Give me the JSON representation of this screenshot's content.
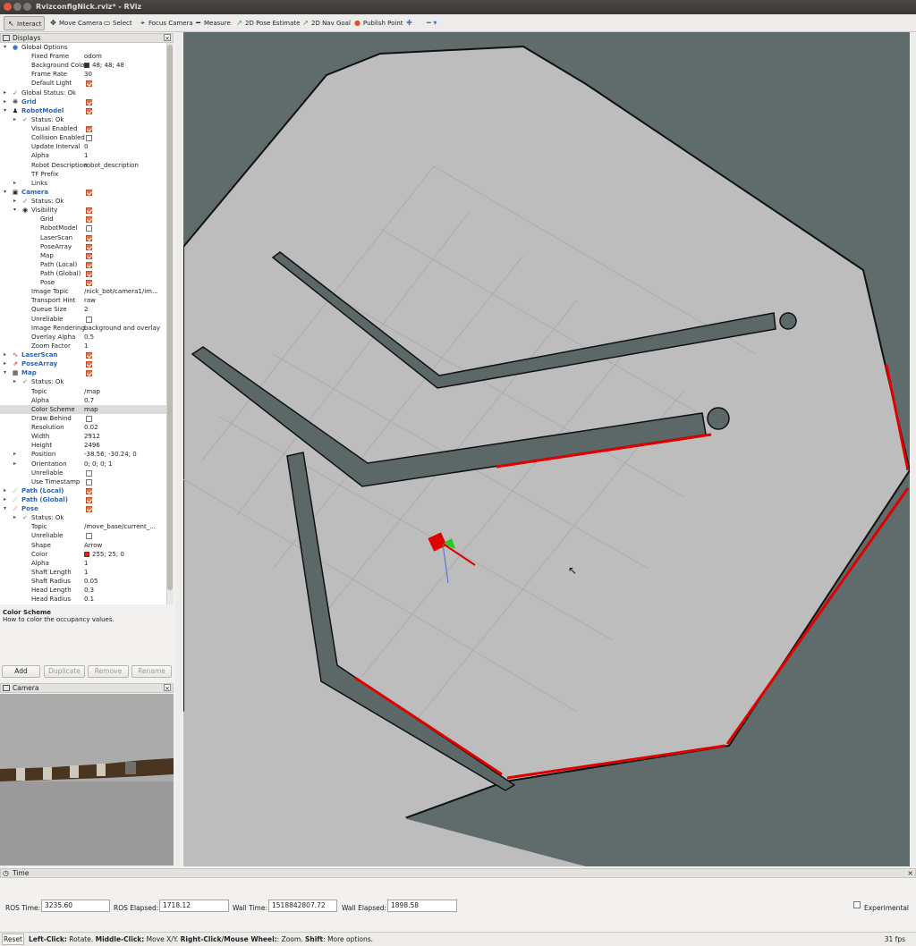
{
  "window": {
    "title": "RvizconfigNick.rviz* - RViz"
  },
  "toolbar": [
    {
      "label": "Interact",
      "icon": "cursor-icon",
      "glyph": "↖"
    },
    {
      "label": "Move Camera",
      "icon": "move-camera-icon",
      "glyph": "✥"
    },
    {
      "label": "Select",
      "icon": "select-icon",
      "glyph": "▭"
    },
    {
      "label": "Focus Camera",
      "icon": "focus-camera-icon",
      "glyph": "⌖"
    },
    {
      "label": "Measure",
      "icon": "measure-icon",
      "glyph": "━"
    },
    {
      "label": "2D Pose Estimate",
      "icon": "pose-estimate-icon",
      "glyph": "↗"
    },
    {
      "label": "2D Nav Goal",
      "icon": "nav-goal-icon",
      "glyph": "↗"
    },
    {
      "label": "Publish Point",
      "icon": "publish-point-icon",
      "glyph": "●"
    },
    {
      "label": "",
      "icon": "plus-icon",
      "glyph": "✚"
    },
    {
      "label": "",
      "icon": "minus-dropdown-icon",
      "glyph": "━ ▾"
    }
  ],
  "colors": {
    "map_gray": "#bdbdbd",
    "obstacle": "#5c6868",
    "laser_red": "#e00000",
    "grid_line": "#a8a8a8",
    "checkbox": "#e8744e",
    "background_color": "#303030",
    "pose_color": "#ff1900"
  },
  "displays": {
    "title": "Displays",
    "rows": [
      {
        "d": 0,
        "arrow": "▾",
        "icon": "globe-icon",
        "glyph": "●",
        "label": "Global Options"
      },
      {
        "d": 1,
        "label": "Fixed Frame",
        "value": "odom"
      },
      {
        "d": 1,
        "label": "Background Color",
        "value": "48; 48; 48",
        "swatch": "#303030"
      },
      {
        "d": 1,
        "label": "Frame Rate",
        "value": "30"
      },
      {
        "d": 1,
        "label": "Default Light",
        "check": true
      },
      {
        "d": 0,
        "arrow": "▸",
        "icon": "check-icon",
        "glyph": "✓",
        "label": "Global Status: Ok"
      },
      {
        "d": 0,
        "arrow": "▸",
        "icon": "grid-icon",
        "glyph": "❋",
        "label": "Grid",
        "blue": true,
        "check": true
      },
      {
        "d": 0,
        "arrow": "▾",
        "icon": "robot-model-icon",
        "glyph": "♟",
        "label": "RobotModel",
        "blue": true,
        "check": true
      },
      {
        "d": 1,
        "arrow": "▸",
        "icon": "check-icon",
        "glyph": "✓",
        "label": "Status: Ok"
      },
      {
        "d": 1,
        "label": "Visual Enabled",
        "check": true
      },
      {
        "d": 1,
        "label": "Collision Enabled",
        "check": false
      },
      {
        "d": 1,
        "label": "Update Interval",
        "value": "0"
      },
      {
        "d": 1,
        "label": "Alpha",
        "value": "1"
      },
      {
        "d": 1,
        "label": "Robot Description",
        "value": "robot_description"
      },
      {
        "d": 1,
        "label": "TF Prefix"
      },
      {
        "d": 1,
        "arrow": "▸",
        "label": "Links"
      },
      {
        "d": 0,
        "arrow": "▾",
        "icon": "camera-icon",
        "glyph": "▣",
        "label": "Camera",
        "blue": true,
        "check": true
      },
      {
        "d": 1,
        "arrow": "▸",
        "icon": "check-icon",
        "glyph": "✓",
        "label": "Status: Ok"
      },
      {
        "d": 1,
        "arrow": "▾",
        "icon": "eye-icon",
        "glyph": "◉",
        "label": "Visibility",
        "check": true
      },
      {
        "d": 2,
        "label": "Grid",
        "check": true
      },
      {
        "d": 2,
        "label": "RobotModel",
        "check": false
      },
      {
        "d": 2,
        "label": "LaserScan",
        "check": true
      },
      {
        "d": 2,
        "label": "PoseArray",
        "check": true
      },
      {
        "d": 2,
        "label": "Map",
        "check": true
      },
      {
        "d": 2,
        "label": "Path (Local)",
        "check": true
      },
      {
        "d": 2,
        "label": "Path (Global)",
        "check": true
      },
      {
        "d": 2,
        "label": "Pose",
        "check": true
      },
      {
        "d": 1,
        "label": "Image Topic",
        "value": "/nick_bot/camera1/im..."
      },
      {
        "d": 1,
        "label": "Transport Hint",
        "value": "raw"
      },
      {
        "d": 1,
        "label": "Queue Size",
        "value": "2"
      },
      {
        "d": 1,
        "label": "Unreliable",
        "check": false
      },
      {
        "d": 1,
        "label": "Image Rendering",
        "value": "background and overlay"
      },
      {
        "d": 1,
        "label": "Overlay Alpha",
        "value": "0.5"
      },
      {
        "d": 1,
        "label": "Zoom Factor",
        "value": "1"
      },
      {
        "d": 0,
        "arrow": "▸",
        "icon": "laser-scan-icon",
        "glyph": "∿",
        "label": "LaserScan",
        "blue": true,
        "check": true
      },
      {
        "d": 0,
        "arrow": "▸",
        "icon": "pose-array-icon",
        "glyph": "⇗",
        "label": "PoseArray",
        "blue": true,
        "check": true
      },
      {
        "d": 0,
        "arrow": "▾",
        "icon": "map-icon",
        "glyph": "▦",
        "label": "Map",
        "blue": true,
        "check": true
      },
      {
        "d": 1,
        "arrow": "▸",
        "icon": "check-icon",
        "glyph": "✓",
        "label": "Status: Ok"
      },
      {
        "d": 1,
        "label": "Topic",
        "value": "/map"
      },
      {
        "d": 1,
        "label": "Alpha",
        "value": "0.7"
      },
      {
        "d": 1,
        "label": "Color Scheme",
        "value": "map",
        "sel": true
      },
      {
        "d": 1,
        "label": "Draw Behind",
        "check": false
      },
      {
        "d": 1,
        "label": "Resolution",
        "value": "0.02"
      },
      {
        "d": 1,
        "label": "Width",
        "value": "2912"
      },
      {
        "d": 1,
        "label": "Height",
        "value": "2496"
      },
      {
        "d": 1,
        "arrow": "▸",
        "label": "Position",
        "value": "-38.56; -30.24; 0"
      },
      {
        "d": 1,
        "arrow": "▸",
        "label": "Orientation",
        "value": "0; 0; 0; 1"
      },
      {
        "d": 1,
        "label": "Unreliable",
        "check": false
      },
      {
        "d": 1,
        "label": "Use Timestamp",
        "check": false
      },
      {
        "d": 0,
        "arrow": "▸",
        "icon": "path-icon",
        "glyph": "⟋",
        "label": "Path (Local)",
        "blue": true,
        "check": true
      },
      {
        "d": 0,
        "arrow": "▸",
        "icon": "path-icon",
        "glyph": "⟋",
        "label": "Path (Global)",
        "blue": true,
        "check": true
      },
      {
        "d": 0,
        "arrow": "▾",
        "icon": "pose-icon",
        "glyph": "⟋",
        "label": "Pose",
        "blue": true,
        "check": true
      },
      {
        "d": 1,
        "arrow": "▸",
        "icon": "check-icon",
        "glyph": "✓",
        "label": "Status: Ok"
      },
      {
        "d": 1,
        "label": "Topic",
        "value": "/move_base/current_..."
      },
      {
        "d": 1,
        "label": "Unreliable",
        "check": false
      },
      {
        "d": 1,
        "label": "Shape",
        "value": "Arrow"
      },
      {
        "d": 1,
        "label": "Color",
        "value": "255; 25; 0",
        "swatch": "#ff1900"
      },
      {
        "d": 1,
        "label": "Alpha",
        "value": "1"
      },
      {
        "d": 1,
        "label": "Shaft Length",
        "value": "1"
      },
      {
        "d": 1,
        "label": "Shaft Radius",
        "value": "0.05"
      },
      {
        "d": 1,
        "label": "Head Length",
        "value": "0.3"
      },
      {
        "d": 1,
        "label": "Head Radius",
        "value": "0.1"
      }
    ],
    "description_title": "Color Scheme",
    "description_text": "How to color the occupancy values.",
    "buttons": {
      "add": "Add",
      "duplicate": "Duplicate",
      "remove": "Remove",
      "rename": "Rename"
    }
  },
  "camera_panel": {
    "title": "Camera"
  },
  "time_panel": {
    "title": "Time",
    "ros_time_label": "ROS Time:",
    "ros_time": "3235.60",
    "ros_elapsed_label": "ROS Elapsed:",
    "ros_elapsed": "1718.12",
    "wall_time_label": "Wall Time:",
    "wall_time": "1518842807.72",
    "wall_elapsed_label": "Wall Elapsed:",
    "wall_elapsed": "1898.58",
    "experimental_label": "Experimental"
  },
  "statusbar": {
    "reset": "Reset",
    "hint_parts": [
      {
        "t": "Left-Click:",
        "b": true
      },
      {
        "t": " Rotate. "
      },
      {
        "t": "Middle-Click:",
        "b": true
      },
      {
        "t": " Move X/Y. "
      },
      {
        "t": "Right-Click/Mouse Wheel:",
        "b": true
      },
      {
        "t": ": Zoom. "
      },
      {
        "t": "Shift",
        "b": true
      },
      {
        "t": ": More options."
      }
    ],
    "fps": "31 fps"
  }
}
